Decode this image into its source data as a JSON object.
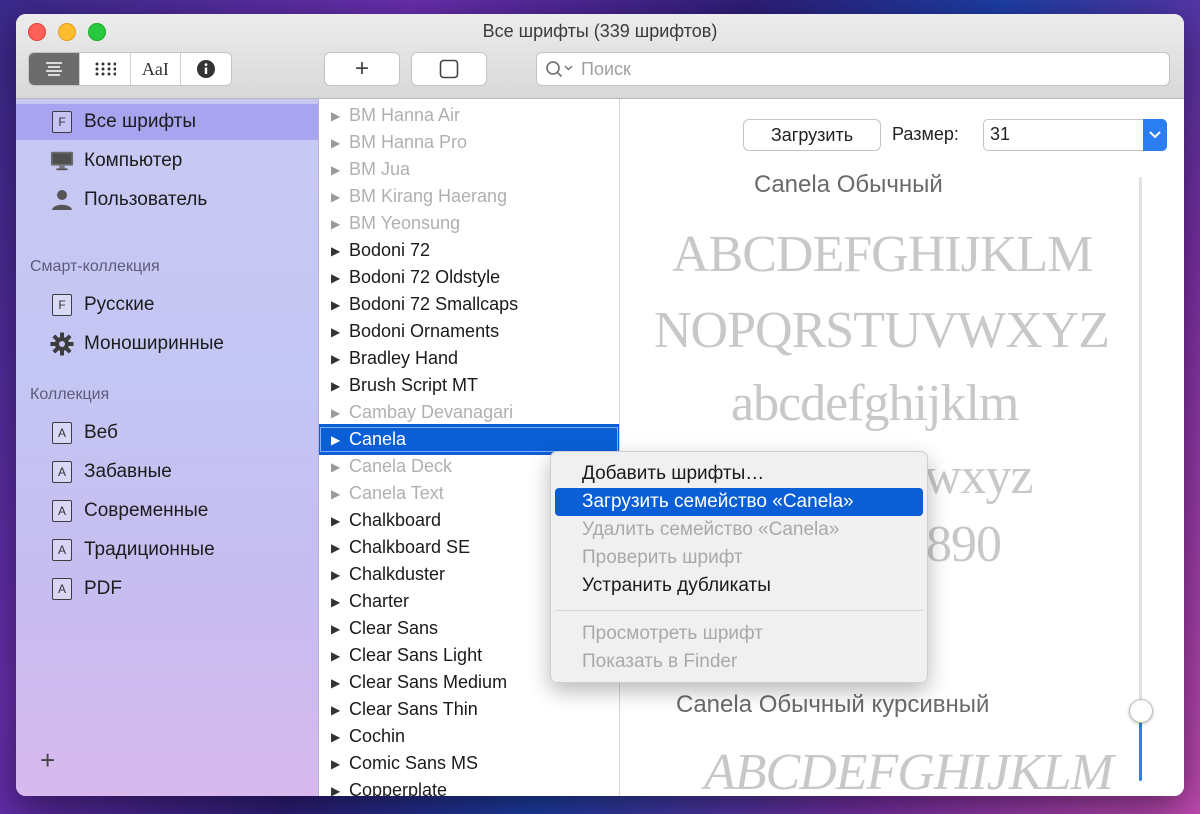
{
  "window": {
    "title": "Все шрифты (339 шрифтов)"
  },
  "toolbar": {
    "view_buttons": [
      {
        "icon": "list-view-icon",
        "active": true
      },
      {
        "icon": "grid-view-icon",
        "active": false
      },
      {
        "icon": "sample-view-icon",
        "label": "AaI",
        "active": false
      },
      {
        "icon": "info-icon",
        "active": false
      }
    ],
    "add_button": "+",
    "search_placeholder": "Поиск"
  },
  "sidebar": {
    "items": [
      {
        "label": "Все шрифты",
        "icon": "font-collection-icon",
        "selected": true
      },
      {
        "label": "Компьютер",
        "icon": "computer-icon"
      },
      {
        "label": "Пользователь",
        "icon": "user-icon"
      }
    ],
    "smart_heading": "Смарт-коллекция",
    "smart_items": [
      {
        "label": "Русские",
        "icon": "font-collection-icon"
      },
      {
        "label": "Моноширинные",
        "icon": "gear-icon"
      }
    ],
    "collection_heading": "Коллекция",
    "collection_items": [
      {
        "label": "Веб"
      },
      {
        "label": "Забавные"
      },
      {
        "label": "Современные"
      },
      {
        "label": "Традиционные"
      },
      {
        "label": "PDF"
      }
    ],
    "add_label": "+"
  },
  "font_list": [
    {
      "name": "BM Hanna Air",
      "state": "dim"
    },
    {
      "name": "BM Hanna Pro",
      "state": "dim"
    },
    {
      "name": "BM Jua",
      "state": "dim"
    },
    {
      "name": "BM Kirang Haerang",
      "state": "dim"
    },
    {
      "name": "BM Yeonsung",
      "state": "dim"
    },
    {
      "name": "Bodoni 72",
      "state": "normal"
    },
    {
      "name": "Bodoni 72 Oldstyle",
      "state": "normal"
    },
    {
      "name": "Bodoni 72 Smallcaps",
      "state": "normal"
    },
    {
      "name": "Bodoni Ornaments",
      "state": "normal"
    },
    {
      "name": "Bradley Hand",
      "state": "normal"
    },
    {
      "name": "Brush Script MT",
      "state": "normal"
    },
    {
      "name": "Cambay Devanagari",
      "state": "dim"
    },
    {
      "name": "Canela",
      "state": "selected"
    },
    {
      "name": "Canela Deck",
      "state": "dim"
    },
    {
      "name": "Canela Text",
      "state": "dim"
    },
    {
      "name": "Chalkboard",
      "state": "normal"
    },
    {
      "name": "Chalkboard SE",
      "state": "normal"
    },
    {
      "name": "Chalkduster",
      "state": "normal"
    },
    {
      "name": "Charter",
      "state": "normal"
    },
    {
      "name": "Clear Sans",
      "state": "normal"
    },
    {
      "name": "Clear Sans Light",
      "state": "normal"
    },
    {
      "name": "Clear Sans Medium",
      "state": "normal"
    },
    {
      "name": "Clear Sans Thin",
      "state": "normal"
    },
    {
      "name": "Cochin",
      "state": "normal"
    },
    {
      "name": "Comic Sans MS",
      "state": "normal"
    },
    {
      "name": "Copperplate",
      "state": "normal"
    }
  ],
  "preview": {
    "download_label": "Загрузить",
    "size_label": "Размер:",
    "size_value": "31",
    "style1_title": "Canela Обычный",
    "line1": "ABCDEFGHIJKLM",
    "line2": "NOPQRSTUVWXYZ",
    "line3": "abcdefghijklm",
    "line4_partial": "wxyz",
    "line5_partial": "890",
    "style2_title": "Canela Обычный курсивный",
    "line6": "ABCDEFGHIJKLM"
  },
  "context_menu": {
    "items": [
      {
        "label": "Добавить шрифты…",
        "state": "normal"
      },
      {
        "label": "Загрузить семейство «Canela»",
        "state": "highlighted"
      },
      {
        "label": "Удалить семейство «Canela»",
        "state": "disabled"
      },
      {
        "label": "Проверить шрифт",
        "state": "disabled"
      },
      {
        "label": "Устранить дубликаты",
        "state": "normal"
      },
      {
        "label": "Просмотреть шрифт",
        "state": "disabled"
      },
      {
        "label": "Показать в Finder",
        "state": "disabled"
      }
    ]
  }
}
